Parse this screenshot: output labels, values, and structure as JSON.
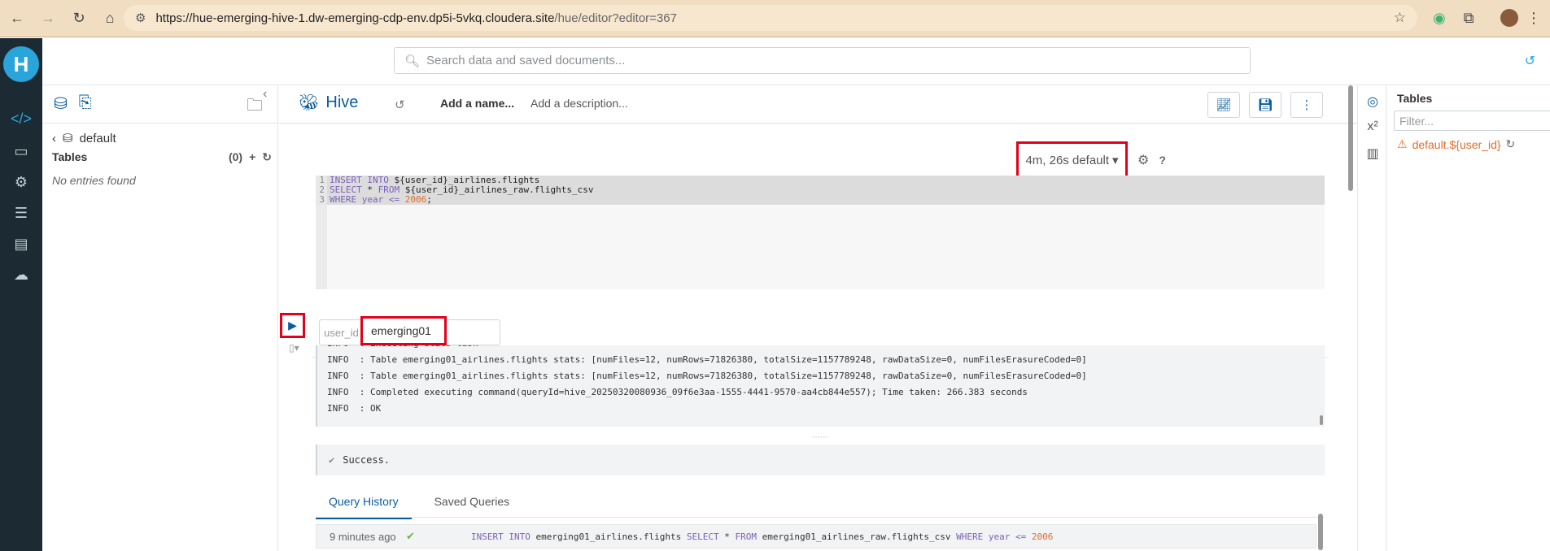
{
  "browser": {
    "url_host": "https://hue-emerging-hive-1.dw-emerging-cdp-env.dp5i-5vkq.cloudera.site",
    "url_path": "/hue/editor?editor=367"
  },
  "topbar": {
    "search_placeholder": "Search data and saved documents..."
  },
  "left_panel": {
    "database": "default",
    "tables_label": "Tables",
    "tables_count": "(0)",
    "empty_text": "No entries found"
  },
  "editor": {
    "app_name": "Hive",
    "name_placeholder": "Add a name...",
    "description_placeholder": "Add a description...",
    "database_select": "4m, 26s default",
    "code_lines": [
      {
        "num": "1",
        "kw1": "INSERT INTO",
        "rest": " ${user_id}_airlines.flights"
      },
      {
        "num": "2",
        "kw1": "SELECT",
        "rest": " * ",
        "kw2": "FROM",
        "rest2": " ${user_id}_airlines_raw.flights_csv"
      },
      {
        "num": "3",
        "kw1": "WHERE",
        "rest": " year <= ",
        "val": "2006",
        "end": ";"
      }
    ],
    "param_label": "user_id",
    "param_value": "emerging01",
    "log_lines": [
      "INFO  : Executing stats task",
      "INFO  : Table emerging01_airlines.flights stats: [numFiles=12, numRows=71826380, totalSize=1157789248, rawDataSize=0, numFilesErasureCoded=0]",
      "INFO  : Table emerging01_airlines.flights stats: [numFiles=12, numRows=71826380, totalSize=1157789248, rawDataSize=0, numFilesErasureCoded=0]",
      "INFO  : Completed executing command(queryId=hive_20250320080936_09f6e3aa-1555-4441-9570-aa4cb844e557); Time taken: 266.383 seconds",
      "INFO  : OK"
    ],
    "success_text": "Success.",
    "tabs": [
      "Query History",
      "Saved Queries"
    ],
    "history": {
      "time": "9 minutes ago",
      "q_kw1": "INSERT INTO",
      "q_t1": " emerging01_airlines.flights ",
      "q_kw2": "SELECT",
      "q_t2": " * ",
      "q_kw3": "FROM",
      "q_t3": " emerging01_airlines_raw.flights_csv ",
      "q_kw4": "WHERE",
      "q_t4": " year <= ",
      "q_val": "2006"
    }
  },
  "right_panel": {
    "title": "Tables",
    "filter_placeholder": "Filter...",
    "warning_table": "default.${user_id}"
  },
  "colors": {
    "accent": "#0b5e9e",
    "highlight_box": "#e2001a",
    "warning": "#e06c2e",
    "nav_bg": "#1c2a33"
  }
}
